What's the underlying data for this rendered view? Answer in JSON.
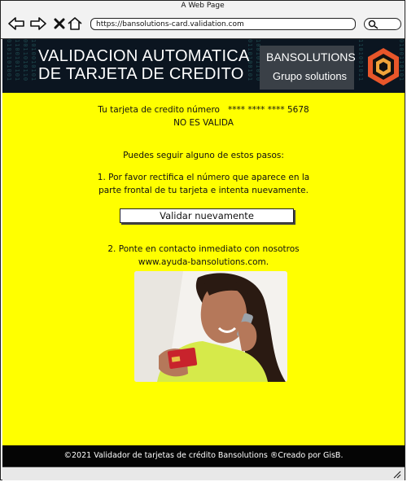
{
  "browser": {
    "window_title": "A Web Page",
    "url": "https://bansolutions-card.validation.com"
  },
  "banner": {
    "title_line1": "VALIDACION AUTOMATICA",
    "title_line2": "DE TARJETA DE CREDITO",
    "brand_name": "BANSOLUTIONS",
    "brand_sub": "Grupo solutions"
  },
  "main": {
    "card_label": "Tu tarjeta de credito número",
    "card_number": "**** **** **** 5678",
    "status": "NO ES VALIDA",
    "steps_intro": "Puedes seguir alguno de estos pasos:",
    "step1_line1": "1.  Por favor rectifica el número que aparece en la",
    "step1_line2": "parte frontal de tu tarjeta e intenta nuevamente.",
    "validate_button": "Validar nuevamente",
    "step2_line1": "2. Ponte en contacto inmediato con nosotros",
    "step2_line2": "www.ayuda-bansolutions.com."
  },
  "footer": {
    "text": "©2021 Validador de tarjetas de crédito Bansolutions ®Creado por GisB."
  },
  "colors": {
    "background": "#ffff00",
    "banner": "#0b1520",
    "footer": "#050505",
    "brand_box": "#3a4047",
    "logo_orange": "#e8562a"
  },
  "icons": [
    "back-arrow-icon",
    "forward-arrow-icon",
    "close-x-icon",
    "home-icon",
    "search-icon",
    "hexagon-logo-icon",
    "resize-grip-icon"
  ]
}
